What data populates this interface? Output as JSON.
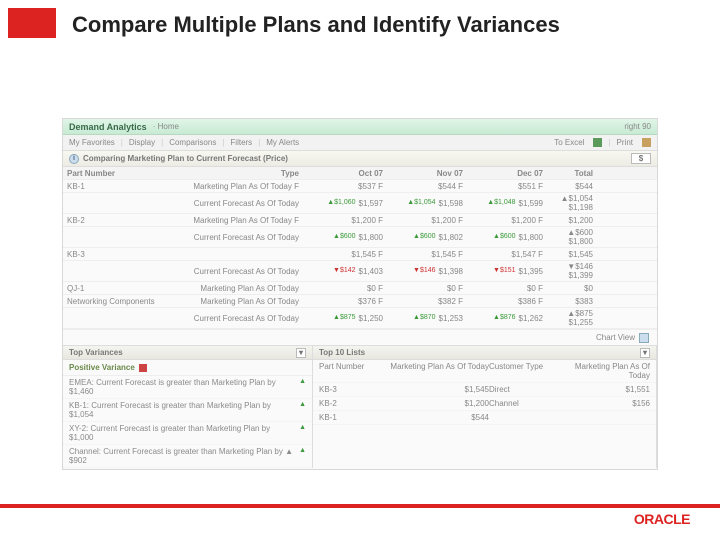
{
  "slide": {
    "title": "Compare Multiple Plans and Identify Variances"
  },
  "header": {
    "brand": "Demand Analytics",
    "home": "· Home",
    "right": "right 90"
  },
  "tabs": {
    "fav": "My Favorites",
    "disp": "Display",
    "comp": "Comparisons",
    "filt": "Filters",
    "alerts": "My Alerts",
    "excel": "To Excel",
    "print": "Print"
  },
  "panel": {
    "title": "Comparing Marketing Plan to Current Forecast (Price)",
    "currency": "$"
  },
  "grid": {
    "headers": {
      "part": "Part Number",
      "type": "Type",
      "m1": "Oct 07",
      "m2": "Nov 07",
      "m3": "Dec 07",
      "tot": "Total"
    },
    "rows": [
      {
        "part": "KB-1",
        "type": "Marketing Plan As Of Today",
        "flag": "F",
        "m1": {
          "v": "$537 F"
        },
        "m2": {
          "v": "$544 F"
        },
        "m3": {
          "v": "$551 F"
        },
        "tot": "$544"
      },
      {
        "part": "",
        "type": "Current Forecast As Of Today",
        "flag": "",
        "m1": {
          "a": "up",
          "d": "▲$1,060",
          "v": "$1,597"
        },
        "m2": {
          "a": "up",
          "d": "▲$1,054",
          "v": "$1,598"
        },
        "m3": {
          "a": "up",
          "d": "▲$1,048",
          "v": "$1,599"
        },
        "tot": "▲$1,054 $1,198"
      },
      {
        "part": "KB-2",
        "type": "Marketing Plan As Of Today",
        "flag": "F",
        "m1": {
          "v": "$1,200 F"
        },
        "m2": {
          "v": "$1,200 F"
        },
        "m3": {
          "v": "$1,200 F"
        },
        "tot": "$1,200"
      },
      {
        "part": "",
        "type": "Current Forecast As Of Today",
        "flag": "",
        "m1": {
          "a": "up",
          "d": "▲$600",
          "v": "$1,800"
        },
        "m2": {
          "a": "up",
          "d": "▲$600",
          "v": "$1,802"
        },
        "m3": {
          "a": "up",
          "d": "▲$600",
          "v": "$1,800"
        },
        "tot": "▲$600 $1,800"
      },
      {
        "part": "KB-3",
        "type": "",
        "flag": "",
        "m1": {
          "v": "$1,545 F"
        },
        "m2": {
          "v": "$1,545 F"
        },
        "m3": {
          "v": "$1,547 F"
        },
        "tot": "$1,545"
      },
      {
        "part": "",
        "type": "Current Forecast As Of Today",
        "flag": "",
        "m1": {
          "a": "dn",
          "d": "▼$142",
          "v": "$1,403"
        },
        "m2": {
          "a": "dn",
          "d": "▼$146",
          "v": "$1,398"
        },
        "m3": {
          "a": "dn",
          "d": "▼$151",
          "v": "$1,395"
        },
        "tot": "▼$146 $1,399"
      },
      {
        "part": "QJ-1",
        "type": "Marketing Plan As Of Today",
        "flag": "",
        "m1": {
          "v": "$0 F"
        },
        "m2": {
          "v": "$0 F"
        },
        "m3": {
          "v": "$0 F"
        },
        "tot": "$0"
      },
      {
        "part": "Networking Components",
        "type": "Marketing Plan As Of Today",
        "flag": "",
        "m1": {
          "v": "$376 F"
        },
        "m2": {
          "v": "$382 F"
        },
        "m3": {
          "v": "$386 F"
        },
        "tot": "$383"
      },
      {
        "part": "",
        "type": "Current Forecast As Of Today",
        "flag": "",
        "m1": {
          "a": "up",
          "d": "▲$875",
          "v": "$1,250"
        },
        "m2": {
          "a": "up",
          "d": "▲$870",
          "v": "$1,253"
        },
        "m3": {
          "a": "up",
          "d": "▲$876",
          "v": "$1,262"
        },
        "tot": "▲$875 $1,255"
      }
    ],
    "chart_view": "Chart View"
  },
  "variances": {
    "title": "Top Variances",
    "pos_title": "Positive Variance",
    "items": [
      "EMEA: Current Forecast is greater than Marketing Plan by $1,460",
      "KB-1: Current Forecast is greater than Marketing Plan by $1,054",
      "XY-2: Current Forecast is greater than Marketing Plan by $1,000",
      "Channel: Current Forecast is greater than Marketing Plan by ▲ $902"
    ]
  },
  "top10": {
    "title": "Top 10 Lists",
    "headers": {
      "part": "Part Number",
      "plan": "Marketing Plan As Of Today",
      "cust": "Customer Type",
      "plan2": "Marketing Plan As Of Today"
    },
    "rows": [
      {
        "part": "KB-3",
        "plan": "$1,545",
        "cust": "Direct",
        "plan2": "$1,551"
      },
      {
        "part": "KB-2",
        "plan": "$1,200",
        "cust": "Channel",
        "plan2": "$156"
      },
      {
        "part": "KB-1",
        "plan": "$544",
        "cust": "",
        "plan2": ""
      }
    ]
  },
  "footer": {
    "brand": "ORACLE"
  }
}
